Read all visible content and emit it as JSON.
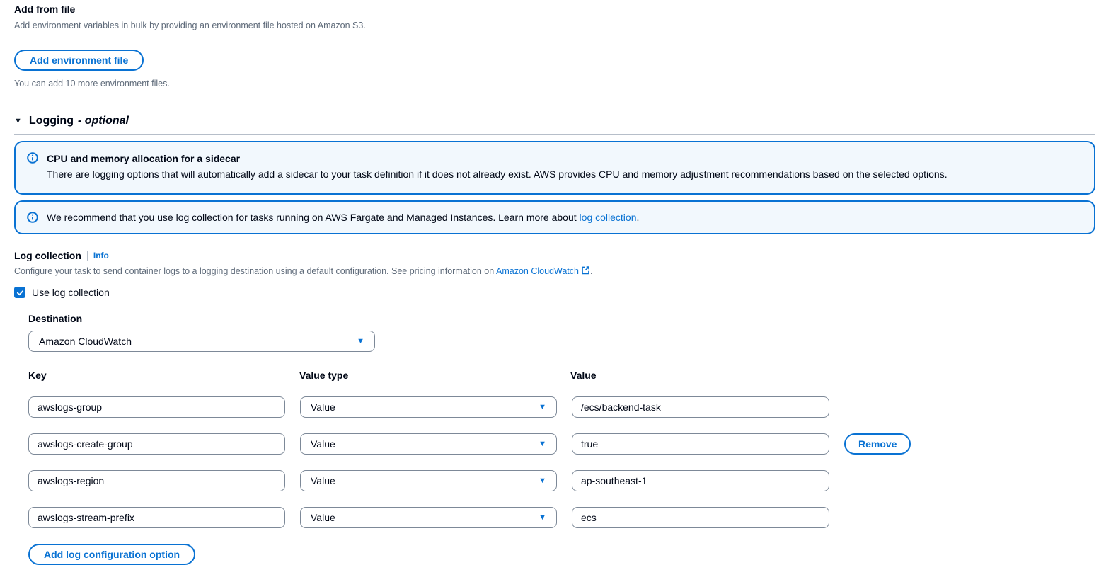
{
  "add_from_file": {
    "title": "Add from file",
    "description": "Add environment variables in bulk by providing an environment file hosted on Amazon S3.",
    "button_label": "Add environment file",
    "hint": "You can add 10 more environment files."
  },
  "logging": {
    "collapse_icon": "▼",
    "title": "Logging",
    "title_suffix": "- optional",
    "alerts": [
      {
        "title": "CPU and memory allocation for a sidecar",
        "text": "There are logging options that will automatically add a sidecar to your task definition if it does not already exist. AWS provides CPU and memory adjustment recommendations based on the selected options."
      },
      {
        "text_before_link": "We recommend that you use log collection for tasks running on AWS Fargate and Managed Instances. Learn more about ",
        "link_label": "log collection",
        "text_after_link": "."
      }
    ],
    "log_collection": {
      "label": "Log collection",
      "info_link_label": "Info",
      "description_before_link": "Configure your task to send container logs to a logging destination using a default configuration. See pricing information on ",
      "pricing_link_label": "Amazon CloudWatch",
      "description_after_link": ".",
      "checkbox_label": "Use log collection",
      "checkbox_checked": true
    },
    "destination": {
      "label": "Destination",
      "selected_option": "Amazon CloudWatch",
      "caret_icon": "▼"
    },
    "options_table": {
      "headers": {
        "key": "Key",
        "value_type": "Value type",
        "value": "Value"
      },
      "rows": [
        {
          "key": "awslogs-group",
          "value_type": "Value",
          "value": "/ecs/backend-task"
        },
        {
          "key": "awslogs-create-group",
          "value_type": "Value",
          "value": "true",
          "remove_label": "Remove"
        },
        {
          "key": "awslogs-region",
          "value_type": "Value",
          "value": "ap-southeast-1"
        },
        {
          "key": "awslogs-stream-prefix",
          "value_type": "Value",
          "value": "ecs"
        }
      ],
      "caret_icon": "▼"
    },
    "add_option_button_label": "Add log configuration option"
  },
  "colors": {
    "accent_blue": "#0972d3",
    "alert_background": "#f2f8fd",
    "dark_text": "#000716",
    "secondary_text": "#5f6b7a",
    "input_border": "#7d8998"
  }
}
